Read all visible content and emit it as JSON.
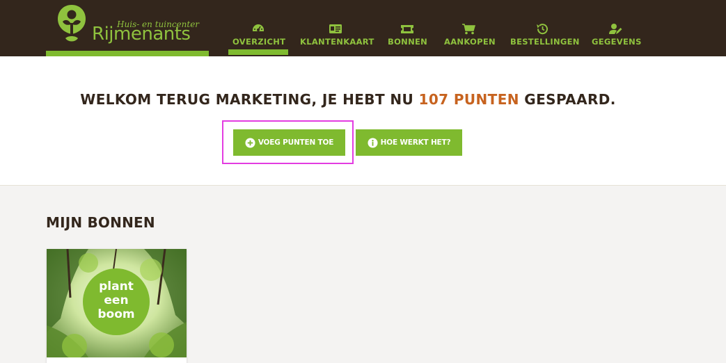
{
  "brand": {
    "subtitle": "Huis- en tuincenter",
    "name": "Rijmenants",
    "color": "#8fc23e"
  },
  "nav": {
    "items": [
      {
        "label": "OVERZICHT",
        "icon": "dashboard-icon",
        "active": true
      },
      {
        "label": "KLANTENKAART",
        "icon": "id-card-icon",
        "active": false
      },
      {
        "label": "BONNEN",
        "icon": "ticket-icon",
        "active": false
      },
      {
        "label": "AANKOPEN",
        "icon": "cart-icon",
        "active": false
      },
      {
        "label": "BESTELLINGEN",
        "icon": "history-icon",
        "active": false
      },
      {
        "label": "GEGEVENS",
        "icon": "user-edit-icon",
        "active": false
      }
    ]
  },
  "welcome": {
    "prefix": "WELKOM TERUG MARKETING, JE HEBT NU",
    "points": "107 PUNTEN",
    "suffix": "GESPAARD.",
    "add_points_label": "VOEG PUNTEN TOE",
    "how_label": "HOE WERKT HET?"
  },
  "bonnen": {
    "title": "MIJN BONNEN",
    "coupons": [
      {
        "text_lines": [
          "plant",
          "een",
          "boom"
        ]
      }
    ]
  },
  "colors": {
    "header_bg": "#33261c",
    "accent_green": "#7fba2f",
    "points_orange": "#c7631f",
    "highlight": "#e33ce1"
  }
}
